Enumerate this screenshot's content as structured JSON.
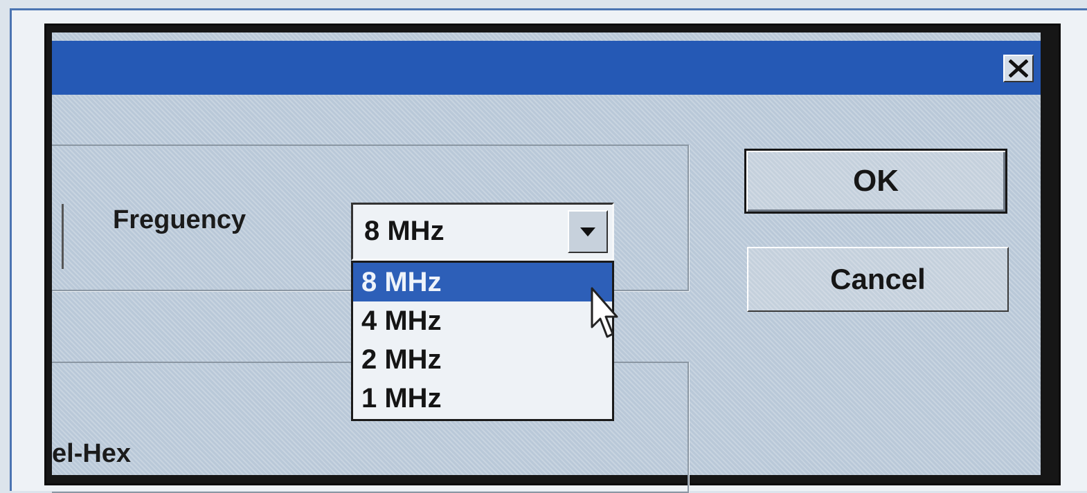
{
  "window": {
    "title": "",
    "close_glyph": "✕"
  },
  "frequency": {
    "label": "Freguency",
    "selected_value": "8 MHz",
    "options": [
      "8 MHz",
      "4 MHz",
      "2 MHz",
      "1 MHz"
    ],
    "highlighted_index": 0
  },
  "partial_label": "el-Hex",
  "buttons": {
    "ok_label": "OK",
    "cancel_label": "Cancel"
  },
  "colors": {
    "titlebar": "#2559b5",
    "selection": "#2d5fb8",
    "dialog_face": "#b9c8d8"
  },
  "icons": {
    "close": "close-icon",
    "dropdown": "chevron-down-icon",
    "pointer": "mouse-pointer-icon"
  }
}
